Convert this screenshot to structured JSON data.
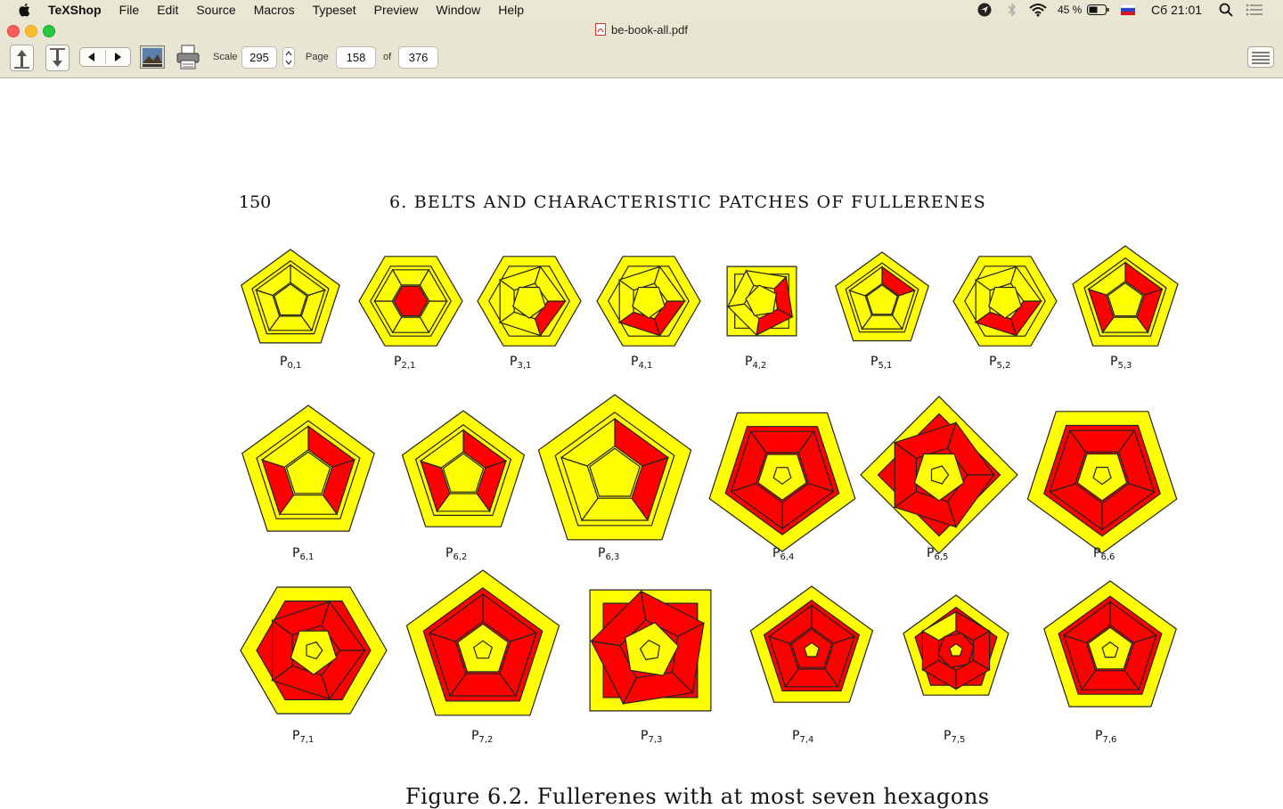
{
  "menubar": {
    "app_name": "TeXShop",
    "items": [
      "File",
      "Edit",
      "Source",
      "Macros",
      "Typeset",
      "Preview",
      "Window",
      "Help"
    ],
    "battery": "45 %",
    "clock": "Сб 21:01"
  },
  "window": {
    "title": "be-book-all.pdf"
  },
  "toolbar": {
    "scale_label": "Scale",
    "scale_value": "295",
    "page_label": "Page",
    "page_value": "158",
    "of_label": "of",
    "total_pages": "376"
  },
  "document": {
    "page_number": "150",
    "running_head": "6. BELTS AND CHARACTERISTIC PATCHES OF FULLERENES",
    "caption": "Figure 6.2. Fullerenes with at most seven hexagons",
    "figures": [
      {
        "id": "P",
        "sub": "0,1"
      },
      {
        "id": "P",
        "sub": "2,1"
      },
      {
        "id": "P",
        "sub": "3,1"
      },
      {
        "id": "P",
        "sub": "4,1"
      },
      {
        "id": "P",
        "sub": "4,2"
      },
      {
        "id": "P",
        "sub": "5,1"
      },
      {
        "id": "P",
        "sub": "5,2"
      },
      {
        "id": "P",
        "sub": "5,3"
      },
      {
        "id": "P",
        "sub": "6,1"
      },
      {
        "id": "P",
        "sub": "6,2"
      },
      {
        "id": "P",
        "sub": "6,3"
      },
      {
        "id": "P",
        "sub": "6,4"
      },
      {
        "id": "P",
        "sub": "6,5"
      },
      {
        "id": "P",
        "sub": "6,6"
      },
      {
        "id": "P",
        "sub": "7,1"
      },
      {
        "id": "P",
        "sub": "7,2"
      },
      {
        "id": "P",
        "sub": "7,3"
      },
      {
        "id": "P",
        "sub": "7,4"
      },
      {
        "id": "P",
        "sub": "7,5"
      },
      {
        "id": "P",
        "sub": "7,6"
      }
    ]
  },
  "colors": {
    "hexagon_fill": "#ff0000",
    "pentagon_fill": "#ffff00",
    "edge": "#222222"
  },
  "icons": [
    "apple-icon",
    "location-icon",
    "bluetooth-icon",
    "wifi-icon",
    "battery-icon",
    "flag-icon",
    "search-icon",
    "list-icon",
    "pdf-icon",
    "up-arrow-icon",
    "down-arrow-icon",
    "back-icon",
    "forward-icon",
    "preview-icon",
    "printer-icon",
    "stepper-icon",
    "sidebar-toggle-icon"
  ]
}
